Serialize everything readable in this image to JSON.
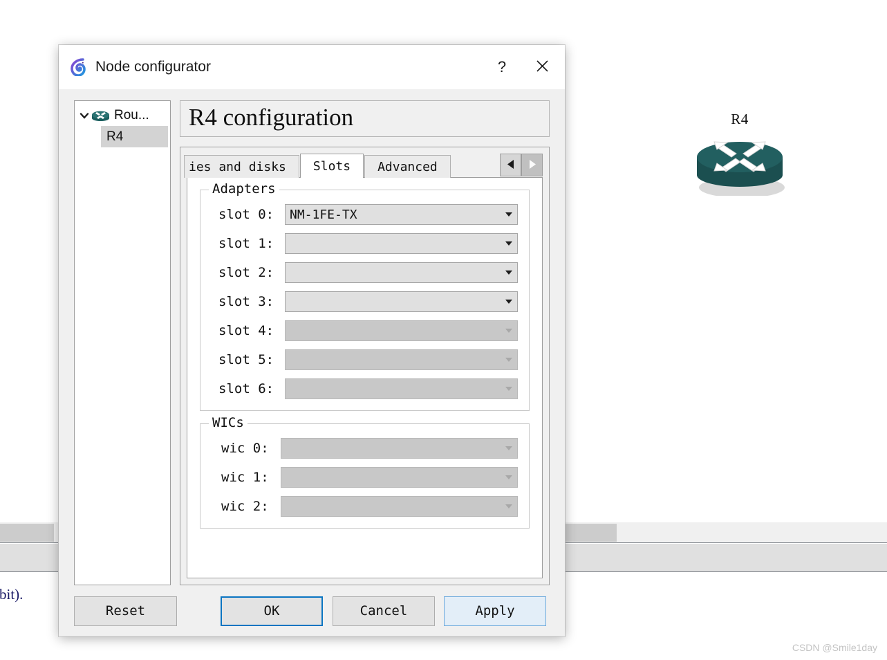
{
  "window": {
    "title": "Node configurator",
    "app_icon": "gns3-chameleon-icon",
    "help_label": "?",
    "close_label": "✕"
  },
  "node_tree": {
    "expander_icon": "chevron-down-icon",
    "root": {
      "label": "Rou...",
      "icon": "router-icon"
    },
    "children": [
      {
        "label": "R4",
        "selected": true
      }
    ]
  },
  "config": {
    "heading": "R4 configuration",
    "tabs": [
      {
        "label": "ies and disks",
        "active": false,
        "clipped": true
      },
      {
        "label": "Slots",
        "active": true,
        "clipped": false
      },
      {
        "label": "Advanced",
        "active": false,
        "clipped": false
      }
    ],
    "tab_scroll": {
      "left_icon": "triangle-left-icon",
      "right_icon": "triangle-right-icon",
      "left_enabled": true,
      "right_enabled": false
    },
    "adapters": {
      "title": "Adapters",
      "rows": [
        {
          "label": "slot 0:",
          "value": "NM-1FE-TX",
          "disabled": false
        },
        {
          "label": "slot 1:",
          "value": "",
          "disabled": false
        },
        {
          "label": "slot 2:",
          "value": "",
          "disabled": false
        },
        {
          "label": "slot 3:",
          "value": "",
          "disabled": false
        },
        {
          "label": "slot 4:",
          "value": "",
          "disabled": true
        },
        {
          "label": "slot 5:",
          "value": "",
          "disabled": true
        },
        {
          "label": "slot 6:",
          "value": "",
          "disabled": true
        }
      ]
    },
    "wics": {
      "title": "WICs",
      "rows": [
        {
          "label": "wic 0:",
          "value": "",
          "disabled": true
        },
        {
          "label": "wic 1:",
          "value": "",
          "disabled": true
        },
        {
          "label": "wic 2:",
          "value": "",
          "disabled": true
        }
      ]
    }
  },
  "footer": {
    "reset_label": "Reset",
    "ok_label": "OK",
    "cancel_label": "Cancel",
    "apply_label": "Apply"
  },
  "canvas": {
    "router_label": "R4",
    "router_icon": "cisco-router-icon"
  },
  "background": {
    "text_fragment": "-bit)."
  },
  "watermark": {
    "text": "CSDN @Smile1day"
  },
  "colors": {
    "dialog_bg": "#f0f0f0",
    "titlebar_bg": "#ffffff",
    "combo_enabled": "#e0e0e0",
    "combo_disabled": "#c8c8c8",
    "focus_blue": "#0a75c2",
    "apply_blue_bg": "#e3eef8",
    "router_teal": "#1f5c5c",
    "selection_grey": "#d3d3d3"
  }
}
